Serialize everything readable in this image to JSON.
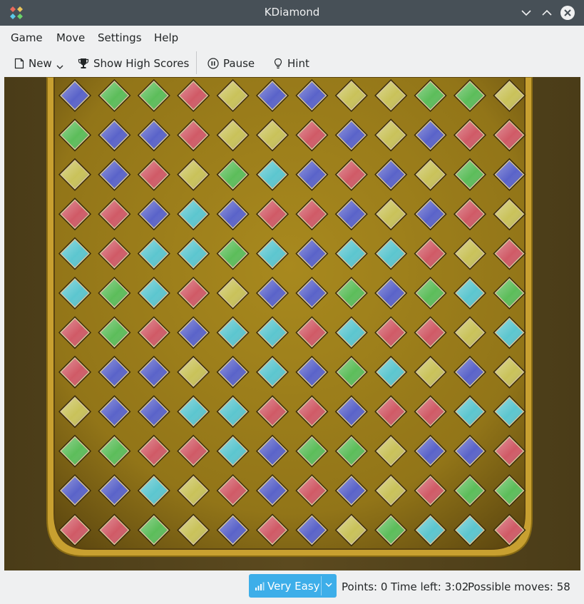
{
  "window": {
    "title": "KDiamond",
    "app_icon": "kdiamond-app-icon",
    "controls": [
      "minimize-icon",
      "maximize-icon",
      "close-icon"
    ]
  },
  "menubar": {
    "items": [
      {
        "label": "Game"
      },
      {
        "label": "Move"
      },
      {
        "label": "Settings"
      },
      {
        "label": "Help"
      }
    ]
  },
  "toolbar": {
    "new_label": "New",
    "new_icon": "document-new-icon",
    "highscores_label": "Show High Scores",
    "highscores_icon": "trophy-icon",
    "pause_label": "Pause",
    "pause_icon": "pause-icon",
    "hint_label": "Hint",
    "hint_icon": "lightbulb-icon"
  },
  "board": {
    "rows": 12,
    "cols": 12,
    "colors": {
      "B": "#5a63c9",
      "G": "#5cbd5a",
      "R": "#d05a66",
      "Y": "#c9c25a",
      "C": "#5cc6cf"
    },
    "grid": [
      "BGGRYBBYYGGY",
      "GBBRYYRBYBRR",
      "YBRYGCBRBYGB",
      "RRBCBRRBYBRY",
      "CRCCGCBCCRYR",
      "CGCRYBBGBGCG",
      "RGRBCCRCRRYC",
      "RBBYBCBGCYBY",
      "YBBCCRRBRRCC",
      "GGRRCBGGYBBR",
      "BBCYRBRBYRGG",
      "RRGYBRBYGCCR"
    ]
  },
  "status": {
    "difficulty": "Very Easy",
    "difficulty_icon": "signal-bars-icon",
    "points": "Points: 0",
    "time_left": "Time left: 3:02",
    "possible_moves": "Possible moves: 58"
  }
}
